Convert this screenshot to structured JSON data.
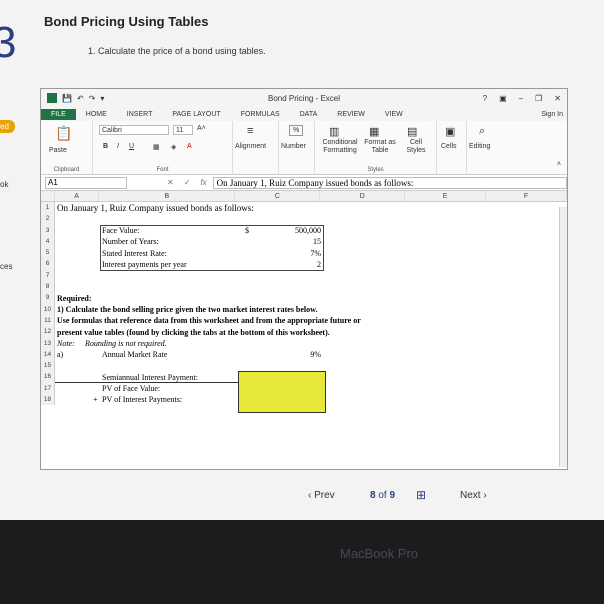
{
  "page": {
    "title": "Bond Pricing Using Tables",
    "task": "1. Calculate the price of a bond using tables.",
    "big_number": "3",
    "left_tabs": [
      "ed",
      "ok",
      "ces"
    ]
  },
  "excel": {
    "window_title": "Bond Pricing - Excel",
    "window_controls": [
      "?",
      "▣",
      "–",
      "❐",
      "✕"
    ],
    "tabs": [
      "FILE",
      "HOME",
      "INSERT",
      "PAGE LAYOUT",
      "FORMULAS",
      "DATA",
      "REVIEW",
      "VIEW"
    ],
    "sign_in": "Sign In",
    "ribbon": {
      "paste": "Paste",
      "clipboard": "Clipboard",
      "font_name": "Calibri",
      "font_size": "11",
      "font_group": "Font",
      "alignment": "Alignment",
      "number": "Number",
      "conditional": "Conditional Formatting",
      "format_table": "Format as Table",
      "cell_styles": "Cell Styles",
      "styles_group": "Styles",
      "cells": "Cells",
      "editing": "Editing",
      "bold": "B",
      "italic": "I",
      "underline": "U",
      "percent": "%"
    },
    "name_box": "A1",
    "fx": "fx",
    "formula": "On January 1, Ruiz Company issued bonds as follows:",
    "columns": [
      "A",
      "B",
      "C",
      "D",
      "E",
      "F"
    ],
    "rows": [
      "1",
      "2",
      "3",
      "4",
      "5",
      "6",
      "7",
      "8",
      "9",
      "10",
      "11",
      "12",
      "13",
      "14",
      "15",
      "16",
      "17",
      "18"
    ],
    "cells": {
      "a1": "On January 1, Ruiz Company issued bonds as follows:",
      "b3": "Face Value:",
      "c3_cur": "$",
      "c3": "500,000",
      "b4": "Number of Years:",
      "c4": "15",
      "b5": "Stated Interest Rate:",
      "c5": "7%",
      "b6": "Interest payments per year",
      "c6": "2",
      "a9": "Required:",
      "a10": "1) Calculate the bond selling price given the two market interest rates below.",
      "a11": "Use formulas that reference data from this worksheet and from the appropriate future or",
      "a12": "present value tables (found by clicking the tabs at the bottom of this worksheet).",
      "a13_label": "Note:",
      "a13": "Rounding is not required.",
      "a14": "a)",
      "b14": "Annual Market Rate",
      "c14": "9%",
      "b16": "Semiannual Interest Payment:",
      "b17": "PV of Face Value:",
      "b18": "PV of Interest Payments:",
      "a18_plus": "+"
    }
  },
  "pager": {
    "prev": "Prev",
    "current": "8",
    "of": "of",
    "total": "9",
    "next": "Next"
  },
  "laptop_brand": "MacBook Pro"
}
